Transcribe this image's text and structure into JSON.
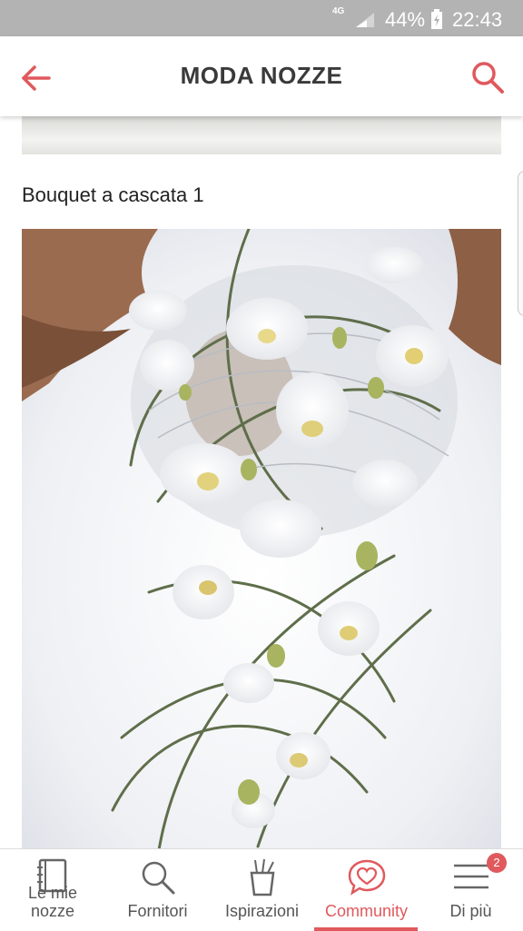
{
  "status_bar": {
    "network": "4G",
    "battery": "44%",
    "time": "22:43"
  },
  "header": {
    "title": "MODA NOZZE",
    "back_icon": "arrow-left-icon",
    "search_icon": "search-icon"
  },
  "photo": {
    "title": "Bouquet a cascata 1"
  },
  "bottom_nav": {
    "items": [
      {
        "label": "Le mie nozze",
        "icon": "notebook-icon"
      },
      {
        "label": "Fornitori",
        "icon": "search-icon"
      },
      {
        "label": "Ispirazioni",
        "icon": "brush-cup-icon"
      },
      {
        "label": "Community",
        "icon": "heart-bubble-icon"
      },
      {
        "label": "Di più",
        "icon": "menu-icon"
      }
    ],
    "active": "Community",
    "badge": "2"
  },
  "colors": {
    "accent": "#e0595d",
    "status_bar": "#b3b3b3",
    "title_text": "#3a3a3a"
  }
}
